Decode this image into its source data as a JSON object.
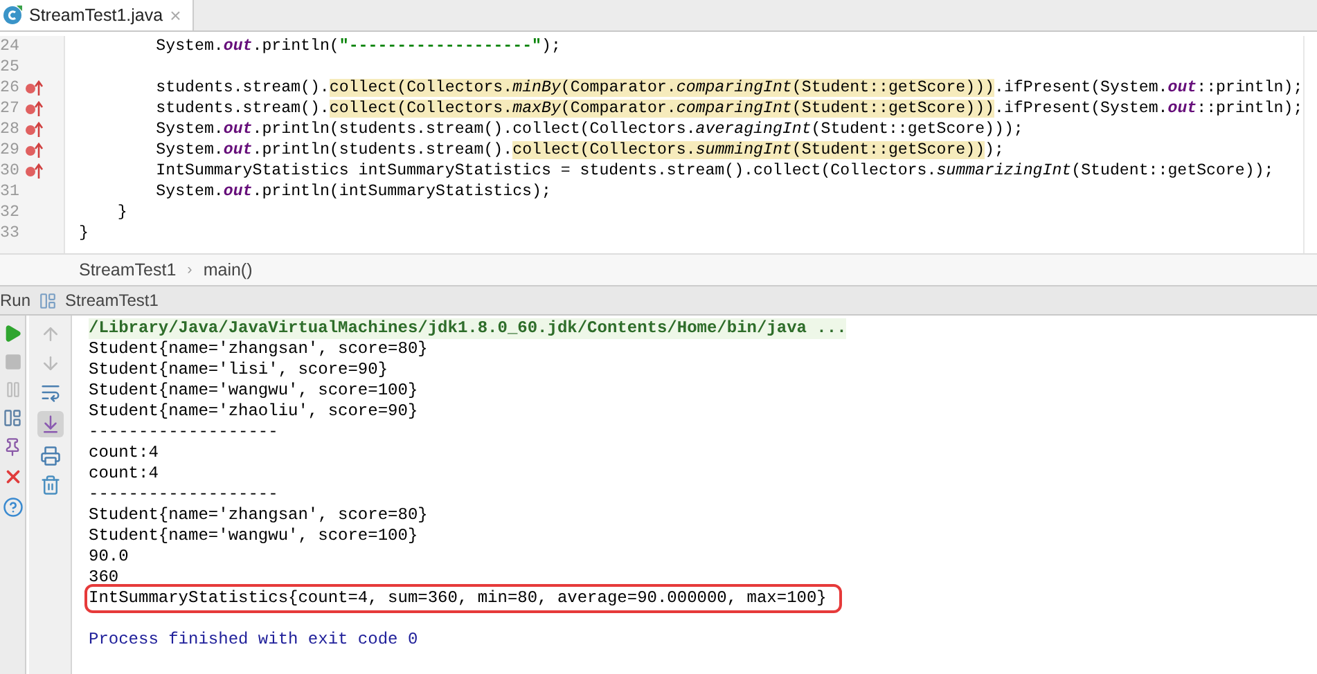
{
  "editor_tab": {
    "label": "StreamTest1.java",
    "selected": true,
    "close": "×"
  },
  "code_lines": [
    {
      "number": "24",
      "marker": false,
      "segments": [
        {
          "text": "        System.",
          "kind": "plain",
          "highlighted": false
        },
        {
          "text": "out",
          "kind": "field",
          "highlighted": false
        },
        {
          "text": ".println(",
          "kind": "plain",
          "highlighted": false
        },
        {
          "text": "\"-------------------\"",
          "kind": "string",
          "highlighted": false
        },
        {
          "text": ");",
          "kind": "plain",
          "highlighted": false
        }
      ]
    },
    {
      "number": "25",
      "marker": false
    },
    {
      "number": "26",
      "marker": true,
      "segments": [
        {
          "text": "        students.stream().",
          "kind": "plain",
          "highlighted": false
        },
        {
          "text": "collect(Collectors.",
          "kind": "plain",
          "highlighted": true
        },
        {
          "text": "minBy",
          "kind": "italic",
          "highlighted": true
        },
        {
          "text": "(Comparator.",
          "kind": "plain",
          "highlighted": true
        },
        {
          "text": "comparingInt",
          "kind": "italic",
          "highlighted": true
        },
        {
          "text": "(Student::getScore)))",
          "kind": "plain",
          "highlighted": true
        },
        {
          "text": ".ifPresent(System.",
          "kind": "plain",
          "highlighted": false
        },
        {
          "text": "out",
          "kind": "field",
          "highlighted": false
        },
        {
          "text": "::println);",
          "kind": "plain",
          "highlighted": false
        }
      ]
    },
    {
      "number": "27",
      "marker": true,
      "segments": [
        {
          "text": "        students.stream().",
          "kind": "plain",
          "highlighted": false
        },
        {
          "text": "collect(Collectors.",
          "kind": "plain",
          "highlighted": true
        },
        {
          "text": "maxBy",
          "kind": "italic",
          "highlighted": true
        },
        {
          "text": "(Comparator.",
          "kind": "plain",
          "highlighted": true
        },
        {
          "text": "comparingInt",
          "kind": "italic",
          "highlighted": true
        },
        {
          "text": "(Student::getScore)))",
          "kind": "plain",
          "highlighted": true
        },
        {
          "text": ".ifPresent(System.",
          "kind": "plain",
          "highlighted": false
        },
        {
          "text": "out",
          "kind": "field",
          "highlighted": false
        },
        {
          "text": "::println);",
          "kind": "plain",
          "highlighted": false
        }
      ]
    },
    {
      "number": "28",
      "marker": true,
      "segments": [
        {
          "text": "        System.",
          "kind": "plain",
          "highlighted": false
        },
        {
          "text": "out",
          "kind": "field",
          "highlighted": false
        },
        {
          "text": ".println(students.stream().collect(Collectors.",
          "kind": "plain",
          "highlighted": false
        },
        {
          "text": "averagingInt",
          "kind": "italic",
          "highlighted": false
        },
        {
          "text": "(Student::getScore)));",
          "kind": "plain",
          "highlighted": false
        }
      ]
    },
    {
      "number": "29",
      "marker": true,
      "segments": [
        {
          "text": "        System.",
          "kind": "plain",
          "highlighted": false
        },
        {
          "text": "out",
          "kind": "field",
          "highlighted": false
        },
        {
          "text": ".println(students.stream().",
          "kind": "plain",
          "highlighted": false
        },
        {
          "text": "collect(Collectors.",
          "kind": "plain",
          "highlighted": true
        },
        {
          "text": "summingInt",
          "kind": "italic",
          "highlighted": true
        },
        {
          "text": "(Student::getScore))",
          "kind": "plain",
          "highlighted": true
        },
        {
          "text": ");",
          "kind": "plain",
          "highlighted": false
        }
      ]
    },
    {
      "number": "30",
      "marker": true,
      "segments": [
        {
          "text": "        IntSummaryStatistics intSummaryStatistics = students.stream().collect(Collectors.",
          "kind": "plain",
          "highlighted": false
        },
        {
          "text": "summarizingInt",
          "kind": "italic",
          "highlighted": false
        },
        {
          "text": "(Student::getScore));",
          "kind": "plain",
          "highlighted": false
        }
      ]
    },
    {
      "number": "31",
      "marker": false,
      "segments": [
        {
          "text": "        System.",
          "kind": "plain",
          "highlighted": false
        },
        {
          "text": "out",
          "kind": "field",
          "highlighted": false
        },
        {
          "text": ".println(intSummaryStatistics);",
          "kind": "plain",
          "highlighted": false
        }
      ]
    },
    {
      "number": "32",
      "marker": false,
      "segments": [
        {
          "text": "    }",
          "kind": "plain",
          "highlighted": false
        }
      ]
    },
    {
      "number": "33",
      "marker": false,
      "segments": [
        {
          "text": "}",
          "kind": "plain",
          "highlighted": false
        }
      ]
    }
  ],
  "breadcrumb": {
    "items": [
      "StreamTest1",
      "main()"
    ],
    "separator": "›"
  },
  "run_panel": {
    "label": "Run",
    "config": "StreamTest1"
  },
  "console_lines": [
    {
      "text": "/Library/Java/JavaVirtualMachines/jdk1.8.0_60.jdk/Contents/Home/bin/java ...",
      "kind": "command"
    },
    {
      "text": "Student{name='zhangsan', score=80}",
      "kind": "output"
    },
    {
      "text": "Student{name='lisi', score=90}",
      "kind": "output"
    },
    {
      "text": "Student{name='wangwu', score=100}",
      "kind": "output"
    },
    {
      "text": "Student{name='zhaoliu', score=90}",
      "kind": "output"
    },
    {
      "text": "-------------------",
      "kind": "output"
    },
    {
      "text": "count:4",
      "kind": "output"
    },
    {
      "text": "count:4",
      "kind": "output"
    },
    {
      "text": "-------------------",
      "kind": "output"
    },
    {
      "text": "Student{name='zhangsan', score=80}",
      "kind": "output"
    },
    {
      "text": "Student{name='wangwu', score=100}",
      "kind": "output"
    },
    {
      "text": "90.0",
      "kind": "output"
    },
    {
      "text": "360",
      "kind": "output"
    },
    {
      "text": "IntSummaryStatistics{count=4, sum=360, min=80, average=90.000000, max=100}",
      "kind": "boxed"
    },
    {
      "kind": "blank"
    },
    {
      "text": "Process finished with exit code 0",
      "kind": "exit"
    }
  ],
  "scroll_to_end_selected": true
}
